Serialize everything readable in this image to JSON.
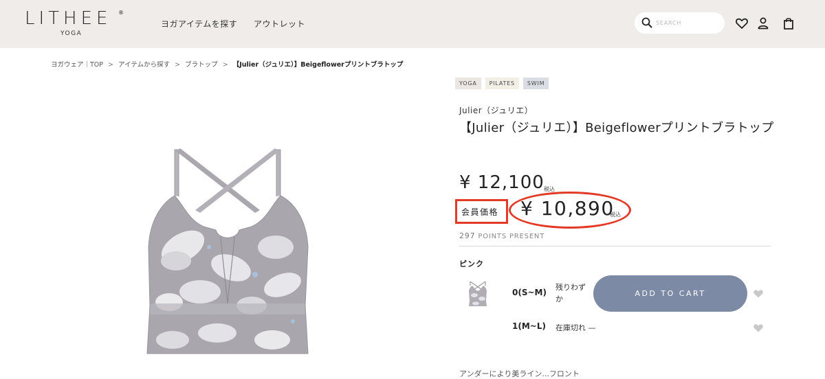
{
  "header": {
    "logo_text": "LITHEE",
    "logo_reg": "®",
    "logo_sub": "YOGA",
    "nav": [
      "ヨガアイテムを探す",
      "アウトレット"
    ],
    "search_placeholder": "SEARCH",
    "icons": [
      "search-icon",
      "heart-icon",
      "user-icon",
      "bag-icon"
    ]
  },
  "breadcrumb": {
    "items": [
      "ヨガウェア｜TOP",
      "アイテムから探す",
      "ブラトップ"
    ],
    "separator": ">",
    "current": "【Julier（ジュリエ）】Beigeflowerプリントブラトップ"
  },
  "product": {
    "tags": [
      "YOGA",
      "PILATES",
      "SWIM"
    ],
    "brand": "Julier（ジュリエ）",
    "title": "【Julier（ジュリエ）】Beigeflowerプリントブラトップ",
    "price": "¥ 12,100",
    "price_tax": "税込",
    "member_label": "会員価格",
    "member_price": "¥ 10,890",
    "member_tax": "税込",
    "points_value": "297",
    "points_label": "POINTS PRESENT",
    "color_name": "ピンク",
    "variants": [
      {
        "size": "0(S~M)",
        "stock": "残りわずか",
        "button": "ADD TO CART"
      },
      {
        "size": "1(M~L)",
        "stock": "在庫切れ —"
      }
    ],
    "description_partial": "アンダーにより美ライン...フロント"
  },
  "colors": {
    "header_bg": "#efecea",
    "accent_red": "#e23a26",
    "cart_button": "#7d8aa6",
    "tag_yoga": "#ebe6e2",
    "tag_pilates": "#f2efe6",
    "tag_swim": "#dadee4"
  }
}
